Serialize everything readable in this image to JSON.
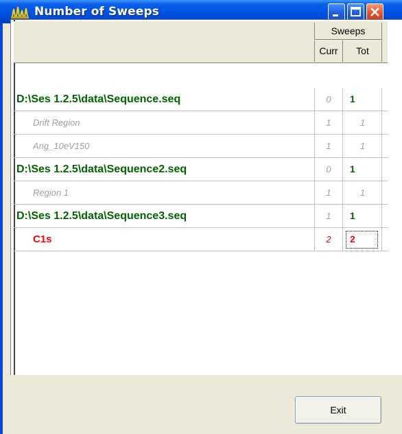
{
  "window": {
    "title": "Number of Sweeps",
    "icon": "app-sweeps-icon",
    "controls": [
      "minimize",
      "maximize",
      "close"
    ]
  },
  "header": {
    "group_label": "Sweeps",
    "curr_label": "Curr",
    "tot_label": "Tot"
  },
  "rows": [
    {
      "type": "sequence",
      "name": "D:\\Ses 1.2.5\\data\\Sequence.seq",
      "curr": "0",
      "tot": "1"
    },
    {
      "type": "region",
      "name": "Drift Region",
      "curr": "1",
      "tot": "1"
    },
    {
      "type": "region",
      "name": "Ang_10eV150",
      "curr": "1",
      "tot": "1"
    },
    {
      "type": "sequence",
      "name": "D:\\Ses 1.2.5\\data\\Sequence2.seq",
      "curr": "0",
      "tot": "1"
    },
    {
      "type": "region",
      "name": "Region 1",
      "curr": "1",
      "tot": "1"
    },
    {
      "type": "sequence",
      "name": "D:\\Ses 1.2.5\\data\\Sequence3.seq",
      "curr": "1",
      "tot": "1"
    },
    {
      "type": "active",
      "name": "C1s",
      "curr": "2",
      "tot": "2"
    }
  ],
  "buttons": {
    "exit_label": "Exit"
  },
  "colors": {
    "sequence_text": "#006400",
    "region_text": "#a0a0a0",
    "active_text": "#ff0000",
    "titlebar": "#0054e3"
  }
}
